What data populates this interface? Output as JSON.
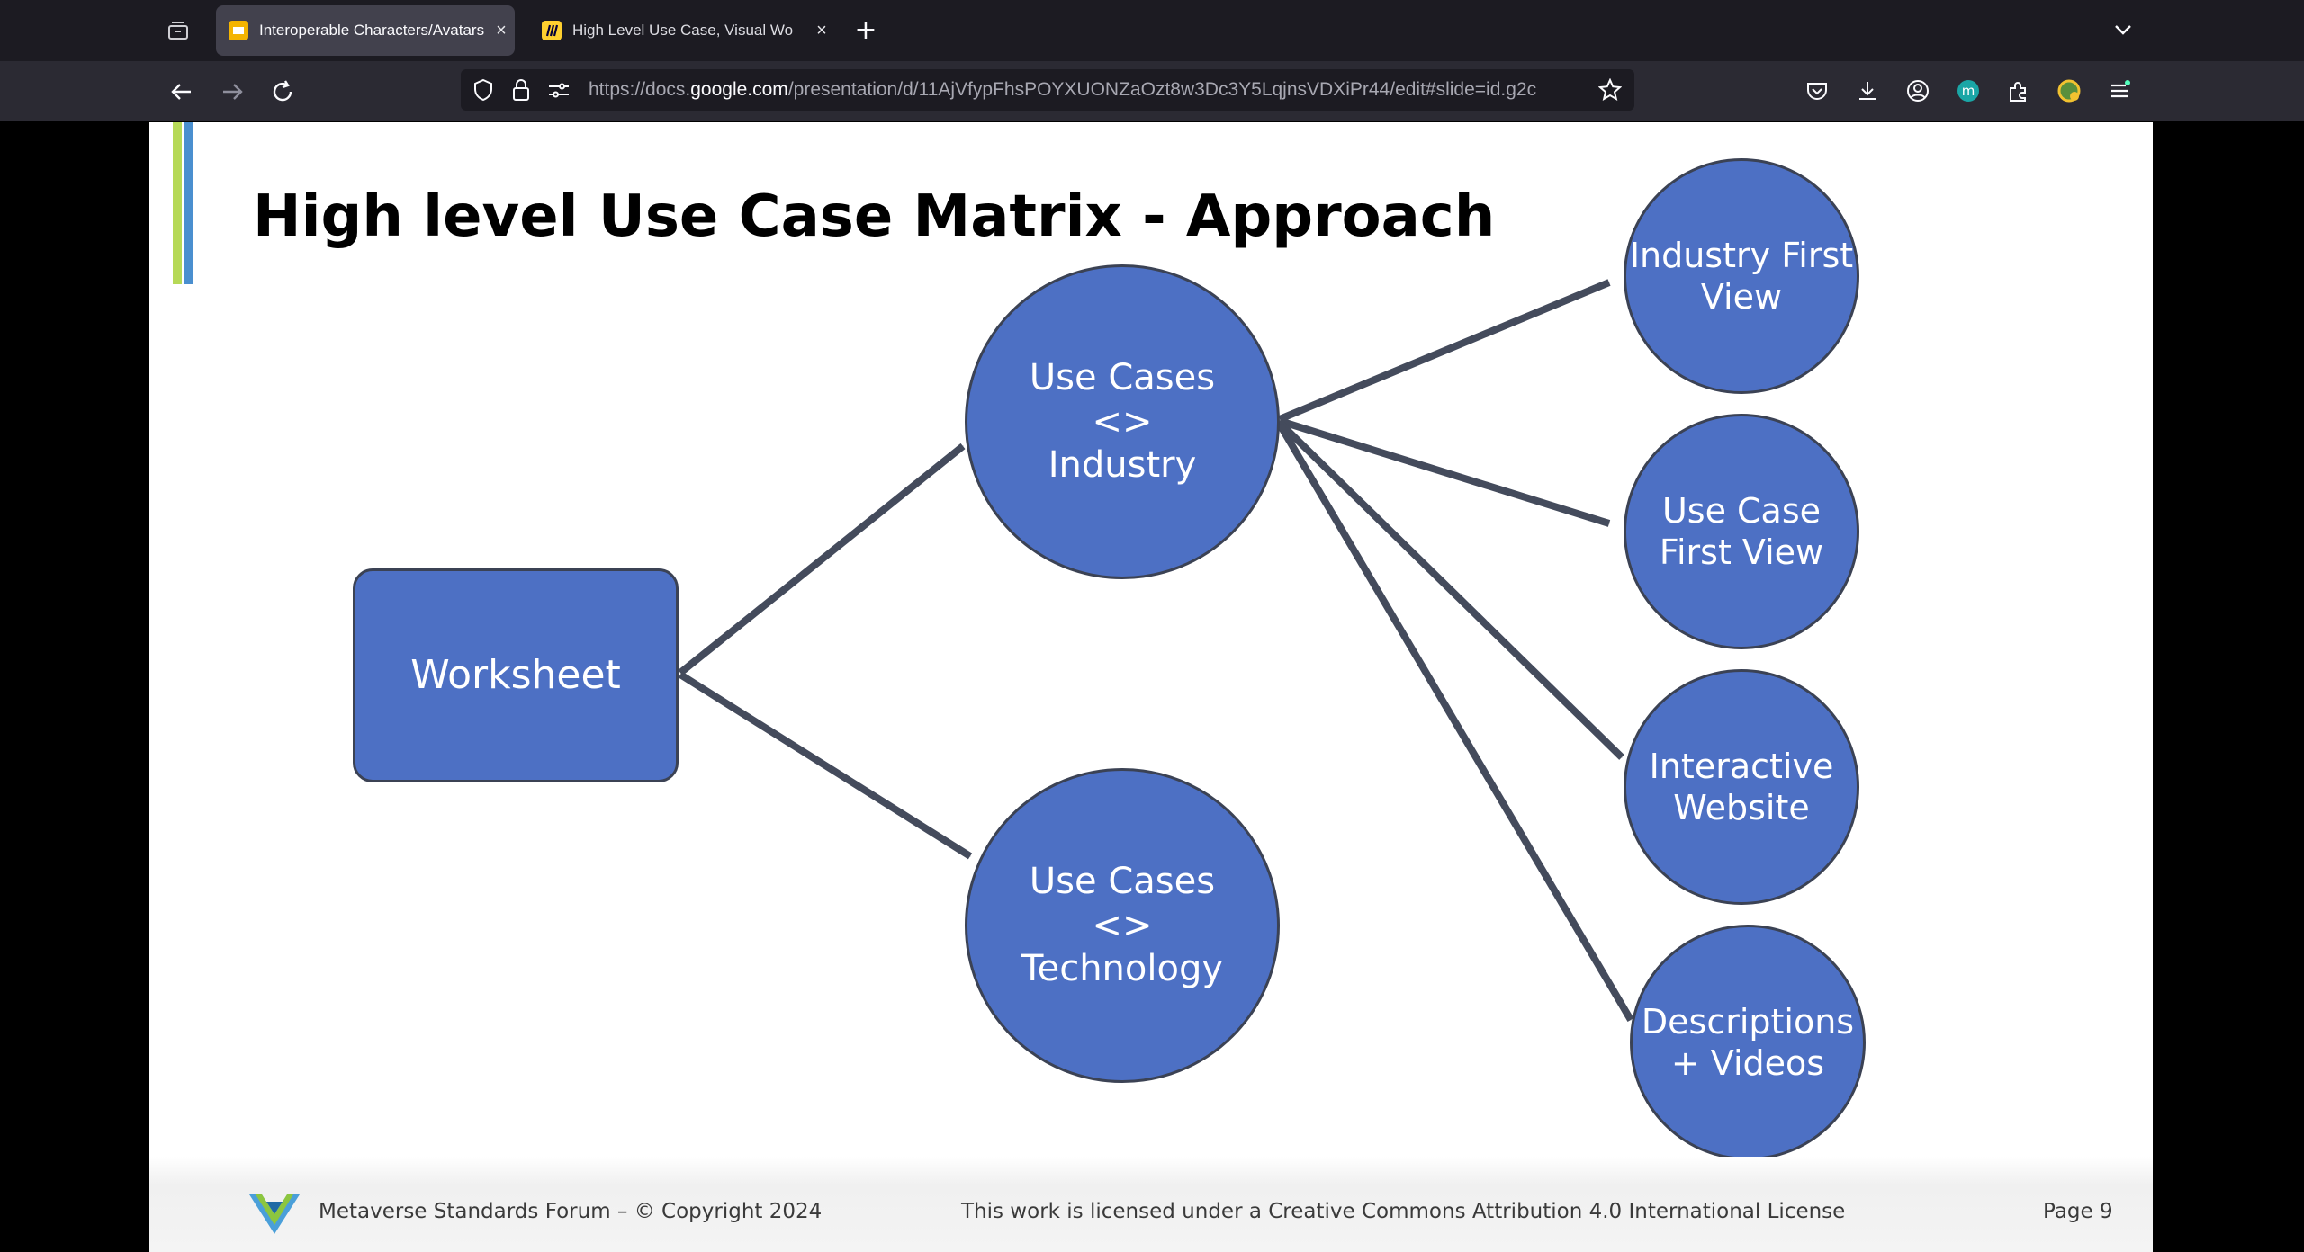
{
  "browser": {
    "tabs": [
      {
        "title": "Interoperable Characters/Avatars",
        "active": true,
        "favicon": "google-slides-icon",
        "favicon_color": "#f4b400"
      },
      {
        "title": "High Level Use Case, Visual Wo",
        "active": false,
        "favicon": "miro-icon",
        "favicon_color": "#ffd02f"
      }
    ],
    "url": {
      "prefix": "https://docs.",
      "host": "google.com",
      "path": "/presentation/d/11AjVfypFhsPOYXUONZaOzt8w3Dc3Y5LqjnsVDXiPr44/edit#slide=id.g2c"
    },
    "toolbar_icons": [
      "pocket-icon",
      "download-icon",
      "account-icon",
      "extension-m-icon",
      "extensions-icon",
      "profile-icon",
      "menu-icon"
    ]
  },
  "slide": {
    "title": "High level Use Case Matrix - Approach",
    "colors": {
      "node_fill": "#4d70c4",
      "node_border": "#3b4254",
      "arrow": "#444b5c",
      "accent_green": "#b6d957",
      "accent_blue": "#4a8fcf"
    },
    "nodes": {
      "worksheet": "Worksheet",
      "use_cases_industry": "Use Cases\n<>\nIndustry",
      "use_cases_technology": "Use Cases\n<>\nTechnology",
      "industry_first_view": "Industry First\nView",
      "use_case_first_view": "Use Case\nFirst View",
      "interactive_website": "Interactive\nWebsite",
      "descriptions_videos": "Descriptions\n+ Videos"
    },
    "edges": [
      {
        "from": "worksheet",
        "to": "use_cases_industry"
      },
      {
        "from": "worksheet",
        "to": "use_cases_technology"
      },
      {
        "from": "use_cases_industry",
        "to": "industry_first_view"
      },
      {
        "from": "use_cases_industry",
        "to": "use_case_first_view"
      },
      {
        "from": "use_cases_industry",
        "to": "interactive_website"
      },
      {
        "from": "use_cases_industry",
        "to": "descriptions_videos"
      }
    ],
    "footer": {
      "org": "Metaverse Standards Forum – © Copyright 2024",
      "license": "This work is licensed under a Creative Commons Attribution 4.0 International License",
      "page": "Page 9"
    }
  }
}
